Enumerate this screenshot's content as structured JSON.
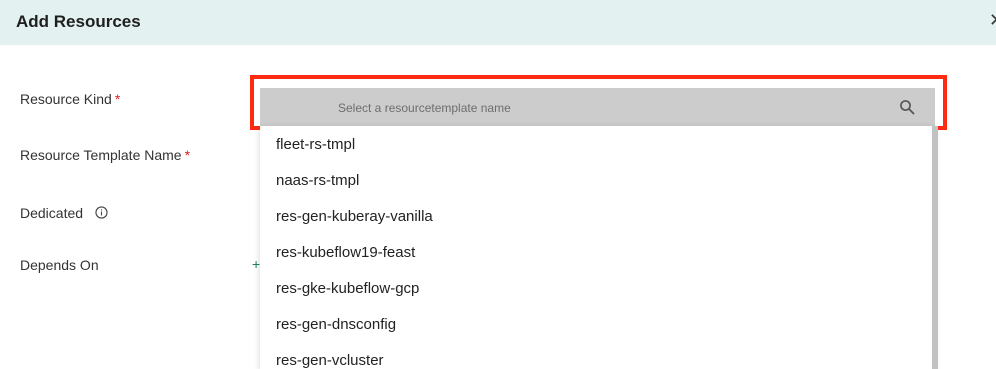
{
  "dialog": {
    "title": "Add Resources",
    "close_icon": "close-icon"
  },
  "form": {
    "resource_kind_label": "Resource Kind",
    "resource_template_name_label": "Resource Template Name",
    "dedicated_label": "Dedicated",
    "depends_on_label": "Depends On",
    "required_marker": "*",
    "add_symbol": "+"
  },
  "dropdown": {
    "search_placeholder": "Select a resourcetemplate name",
    "search_icon": "search-icon",
    "options": [
      "fleet-rs-tmpl",
      "naas-rs-tmpl",
      "res-gen-kuberay-vanilla",
      "res-kubeflow19-feast",
      "res-gke-kubeflow-gcp",
      "res-gen-dnsconfig",
      "res-gen-vcluster"
    ]
  },
  "colors": {
    "header_bg": "#e3f1f1",
    "highlight": "#ff2a12",
    "required": "#e02020",
    "accent": "#1a7f64"
  }
}
